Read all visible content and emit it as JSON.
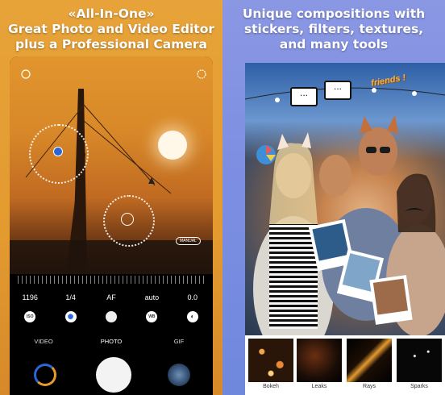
{
  "left": {
    "headline": [
      "«All-In-One»",
      "Great Photo and Video Editor",
      "plus a Professional Camera"
    ],
    "camera": {
      "manual_tag": "MANUAL",
      "settings": [
        "1196",
        "1/4",
        "AF",
        "auto",
        "0.0"
      ],
      "setting_icons": [
        "ISO",
        "shutter",
        "AF",
        "WB",
        "exposure"
      ],
      "modes": [
        "VIDEO",
        "PHOTO",
        "GIF"
      ],
      "active_mode": "PHOTO"
    }
  },
  "right": {
    "headline": [
      "Unique compositions with",
      "stickers, filters, textures,",
      "and many tools"
    ],
    "sticker_text": "friends !",
    "speech_bubble": "...",
    "filters": [
      "Bokeh",
      "Leaks",
      "Rays",
      "Sparks"
    ]
  },
  "colors": {
    "left_bg": "#e39a2f",
    "right_bg": "#7e8fe2",
    "accent_orange": "#f3b14b"
  }
}
